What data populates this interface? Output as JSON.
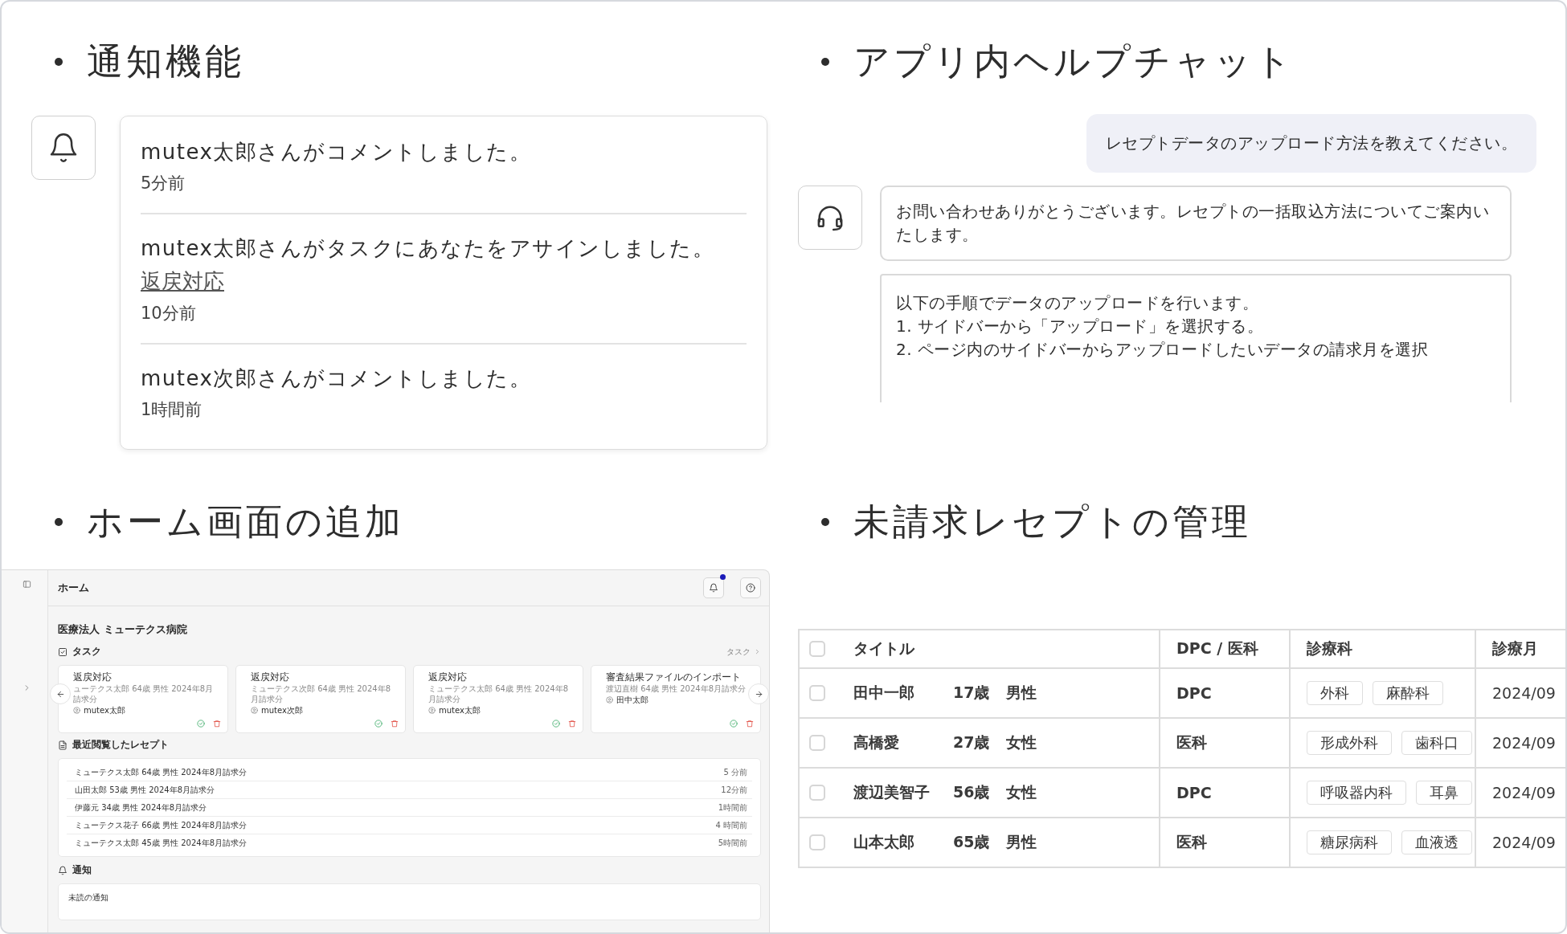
{
  "notifications": {
    "heading": "通知機能",
    "items": [
      {
        "message": "mutex太郎さんがコメントしました。",
        "time": "5分前"
      },
      {
        "message": "mutex太郎さんがタスクにあなたをアサインしました。",
        "link": "返戻対応",
        "time": "10分前"
      },
      {
        "message": "mutex次郎さんがコメントしました。",
        "time": "1時間前"
      }
    ]
  },
  "help_chat": {
    "heading": "アプリ内ヘルプチャット",
    "messages": [
      {
        "kind": "user",
        "text": "レセプトデータのアップロード方法を教えてください。"
      },
      {
        "kind": "bot",
        "text": "お問い合わせありがとうございます。レセプトの一括取込方法についてご案内いたします。"
      },
      {
        "kind": "bot_faded",
        "text": "以下の手順でデータのアップロードを行います。\n1. サイドバーから「アップロード」を選択する。\n2. ページ内のサイドバーからアップロードしたいデータの請求月を選択"
      }
    ]
  },
  "home_screen": {
    "heading": "ホーム画面の追加",
    "screen": {
      "title": "ホーム",
      "has_unread": true,
      "organization": "医療法人 ミューテクス病院",
      "tasks": {
        "heading": "タスク",
        "link": "タスク",
        "cards": [
          {
            "title": "返戻対応",
            "subtitle": "ューテクス太郎 64歳 男性 2024年8月請求分",
            "assignee": "mutex太郎"
          },
          {
            "title": "返戻対応",
            "subtitle": "ミューテクス次郎 64歳 男性 2024年8月請求分",
            "assignee": "mutex次郎"
          },
          {
            "title": "返戻対応",
            "subtitle": "ミューテクス太郎 64歳 男性 2024年8月請求分",
            "assignee": "mutex太郎"
          },
          {
            "title": "審査結果ファイルのインポート",
            "subtitle": "渡辺直樹 64歳 男性 2024年8月請求分",
            "assignee": "田中太郎"
          }
        ]
      },
      "recent": {
        "heading": "最近閲覧したレセプト",
        "rows": [
          {
            "text": "ミューテクス太郎 64歳 男性 2024年8月請求分",
            "time": "5 分前"
          },
          {
            "text": "山田太郎 53歳 男性 2024年8月請求分",
            "time": "12分前"
          },
          {
            "text": "伊藤元 34歳 男性 2024年8月請求分",
            "time": "1時間前"
          },
          {
            "text": "ミューテクス花子 66歳 男性 2024年8月請求分",
            "time": "4 時間前"
          },
          {
            "text": "ミューテクス太郎 45歳 男性 2024年8月請求分",
            "time": "5時間前"
          }
        ]
      },
      "notices": {
        "heading": "通知",
        "label": "未読の通知"
      }
    }
  },
  "receipts": {
    "heading": "未請求レセプトの管理",
    "table": {
      "all_checked": false,
      "columns": [
        "タイトル",
        "DPC / 医科",
        "診療科",
        "診療月"
      ],
      "rows": [
        {
          "checked": false,
          "name": "田中一郎",
          "age": "17歳",
          "sex": "男性",
          "type": "DPC",
          "departments": [
            "外科",
            "麻酔科"
          ],
          "month": "2024/09"
        },
        {
          "checked": false,
          "name": "高橋愛",
          "age": "27歳",
          "sex": "女性",
          "type": "医科",
          "departments": [
            "形成外科",
            "歯科口"
          ],
          "month": "2024/09"
        },
        {
          "checked": false,
          "name": "渡辺美智子",
          "age": "56歳",
          "sex": "女性",
          "type": "DPC",
          "departments": [
            "呼吸器内科",
            "耳鼻"
          ],
          "month": "2024/09"
        },
        {
          "checked": false,
          "name": "山本太郎",
          "age": "65歳",
          "sex": "男性",
          "type": "医科",
          "departments": [
            "糖尿病科",
            "血液透"
          ],
          "month": "2024/09"
        }
      ]
    }
  }
}
